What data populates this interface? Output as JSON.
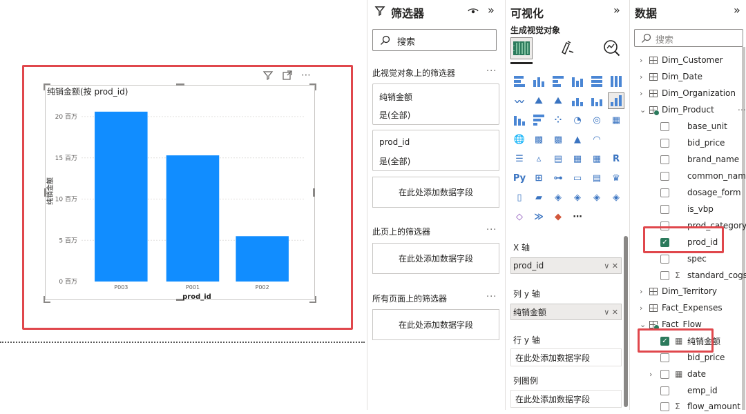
{
  "canvas": {
    "visual_title": "纯销金额(按 prod_id)",
    "chart_data": {
      "type": "bar",
      "categories": [
        "P003",
        "P001",
        "P002"
      ],
      "values": [
        20.6,
        15.3,
        5.5
      ],
      "ylabel": "纯销金额",
      "xlabel": "prod_id",
      "y_tick_labels": [
        "0 百万",
        "5 百万",
        "10 百万",
        "15 百万",
        "20 百万"
      ],
      "y_ticks": [
        0,
        5,
        10,
        15,
        20
      ],
      "ylim": [
        0,
        22
      ],
      "grid": true,
      "bar_color": "#118dff"
    }
  },
  "filters": {
    "title": "筛选器",
    "search_placeholder": "搜索",
    "section_visual": "此视觉对象上的筛选器",
    "cards": [
      {
        "field": "纯销金额",
        "state": "是(全部)"
      },
      {
        "field": "prod_id",
        "state": "是(全部)"
      }
    ],
    "add_field": "在此处添加数据字段",
    "section_page": "此页上的筛选器",
    "section_all": "所有页面上的筛选器"
  },
  "viz": {
    "title": "可视化",
    "subtitle": "生成视觉对象",
    "wells": {
      "x_axis_label": "X 轴",
      "x_axis_field": "prod_id",
      "col_y_label": "列 y 轴",
      "col_y_field": "纯销金额",
      "row_y_label": "行 y 轴",
      "row_y_placeholder": "在此处添加数据字段",
      "legend_label": "列图例",
      "legend_placeholder": "在此处添加数据字段"
    }
  },
  "data": {
    "title": "数据",
    "search_placeholder": "搜索",
    "tables": {
      "dim_customer": "Dim_Customer",
      "dim_date": "Dim_Date",
      "dim_organization": "Dim_Organization",
      "dim_product": "Dim_Product",
      "dim_territory": "Dim_Territory",
      "fact_expenses": "Fact_Expenses",
      "fact_flow": "Fact_Flow"
    },
    "product_fields": [
      "base_unit",
      "bid_price",
      "brand_name",
      "common_name",
      "dosage_form",
      "is_vbp",
      "prod_category",
      "prod_id",
      "spec",
      "standard_cogs"
    ],
    "flow_fields": [
      "纯销金额",
      "bid_price",
      "date",
      "emp_id",
      "flow_amount"
    ]
  },
  "colors": {
    "accent": "#118dff",
    "highlight": "#e0474c",
    "check": "#2b7a5c"
  }
}
